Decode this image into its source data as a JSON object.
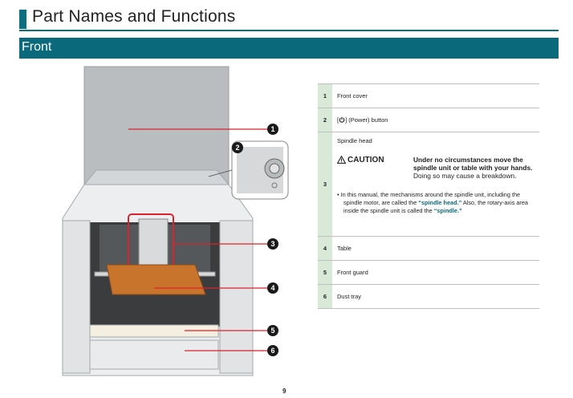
{
  "header": {
    "title": "Part Names and Functions"
  },
  "section": {
    "title": "Front"
  },
  "callouts": [
    "1",
    "2",
    "3",
    "4",
    "5",
    "6"
  ],
  "parts": [
    {
      "num": "1",
      "label_before": "",
      "label": "Front cover",
      "icon": "power-icon"
    },
    {
      "num": "2",
      "label_before": "[",
      "label": "] (Power) button",
      "icon": "power-icon"
    },
    {
      "num": "3",
      "label": "Spindle head",
      "caution": {
        "label": "CAUTION",
        "bold_text": "Under no circumstances move the spindle unit or table with your hands.",
        "text": "Doing so may cause a breakdown."
      },
      "note": {
        "bullet": "•",
        "part1": "In this manual, the mechanisms around the spindle unit, including the spindle motor, are called the",
        "term1": "“spindle head.”",
        "part2": "Also, the rotary-axis area inside the spindle unit is called the",
        "term2": "“spindle.”"
      }
    },
    {
      "num": "4",
      "label": "Table"
    },
    {
      "num": "5",
      "label": "Front guard"
    },
    {
      "num": "6",
      "label": "Dust tray"
    }
  ],
  "footer": {
    "page_number": "9"
  },
  "colors": {
    "accent": "#0a6a7c",
    "number_cell": "#d8ead7",
    "callout_line": "#d9232e"
  }
}
